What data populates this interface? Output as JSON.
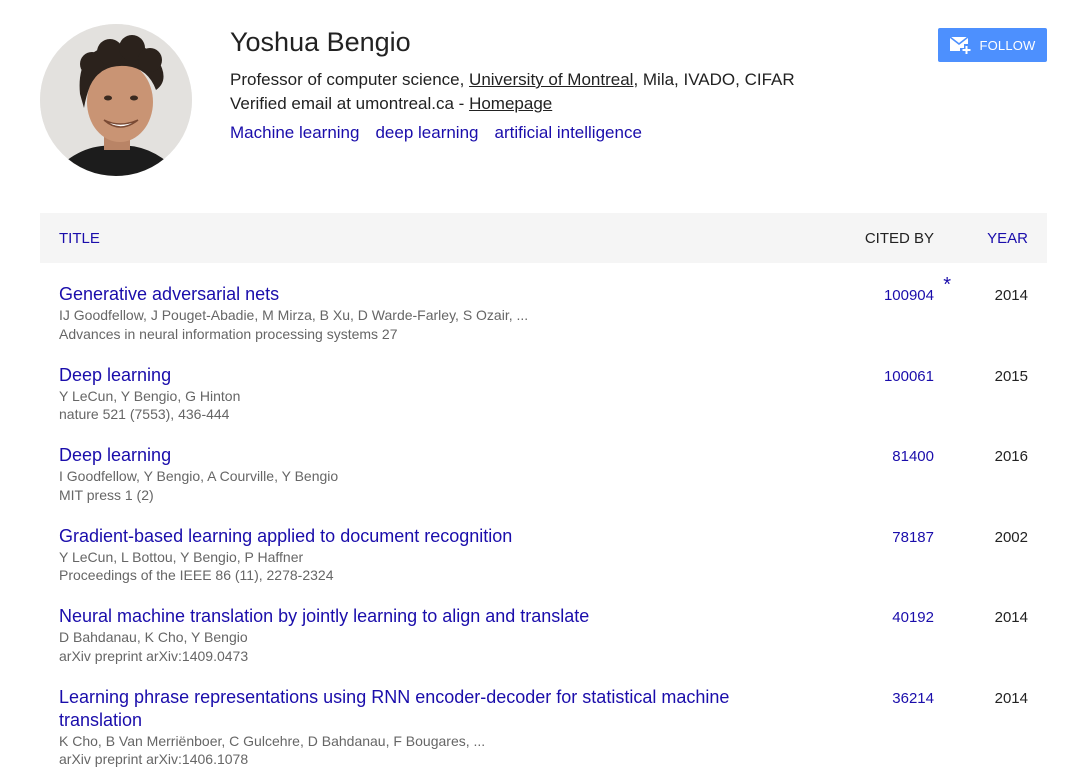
{
  "profile": {
    "name": "Yoshua Bengio",
    "affiliation_prefix": "Professor of computer science, ",
    "affiliation_link": "University of Montreal",
    "affiliation_suffix": ", Mila, IVADO, CIFAR",
    "email_text": "Verified email at umontreal.ca - ",
    "homepage_label": "Homepage",
    "interests": [
      "Machine learning",
      "deep learning",
      "artificial intelligence"
    ]
  },
  "follow": {
    "label": "FOLLOW"
  },
  "table": {
    "headers": {
      "title": "TITLE",
      "cited_by": "CITED BY",
      "year": "YEAR"
    },
    "rows": [
      {
        "title": "Generative adversarial nets",
        "authors": "IJ Goodfellow, J Pouget-Abadie, M Mirza, B Xu, D Warde-Farley, S Ozair, ...",
        "venue": "Advances in neural information processing systems 27",
        "cited_by": "100904",
        "star": "*",
        "year": "2014"
      },
      {
        "title": "Deep learning",
        "authors": "Y LeCun, Y Bengio, G Hinton",
        "venue": "nature 521 (7553), 436-444",
        "cited_by": "100061",
        "star": "",
        "year": "2015"
      },
      {
        "title": "Deep learning",
        "authors": "I Goodfellow, Y Bengio, A Courville, Y Bengio",
        "venue": "MIT press 1 (2)",
        "cited_by": "81400",
        "star": "",
        "year": "2016"
      },
      {
        "title": "Gradient-based learning applied to document recognition",
        "authors": "Y LeCun, L Bottou, Y Bengio, P Haffner",
        "venue": "Proceedings of the IEEE 86 (11), 2278-2324",
        "cited_by": "78187",
        "star": "",
        "year": "2002"
      },
      {
        "title": "Neural machine translation by jointly learning to align and translate",
        "authors": "D Bahdanau, K Cho, Y Bengio",
        "venue": "arXiv preprint arXiv:1409.0473",
        "cited_by": "40192",
        "star": "",
        "year": "2014"
      },
      {
        "title": "Learning phrase representations using RNN encoder-decoder for statistical machine translation",
        "authors": "K Cho, B Van Merriënboer, C Gulcehre, D Bahdanau, F Bougares, ...",
        "venue": "arXiv preprint arXiv:1406.1078",
        "cited_by": "36214",
        "star": "",
        "year": "2014"
      }
    ]
  },
  "colors": {
    "link": "#1a0dab",
    "button": "#4d90fe",
    "header_bg": "#f5f5f5",
    "meta_text": "#666666"
  },
  "icons": {
    "follow": "mail-plus-icon"
  }
}
